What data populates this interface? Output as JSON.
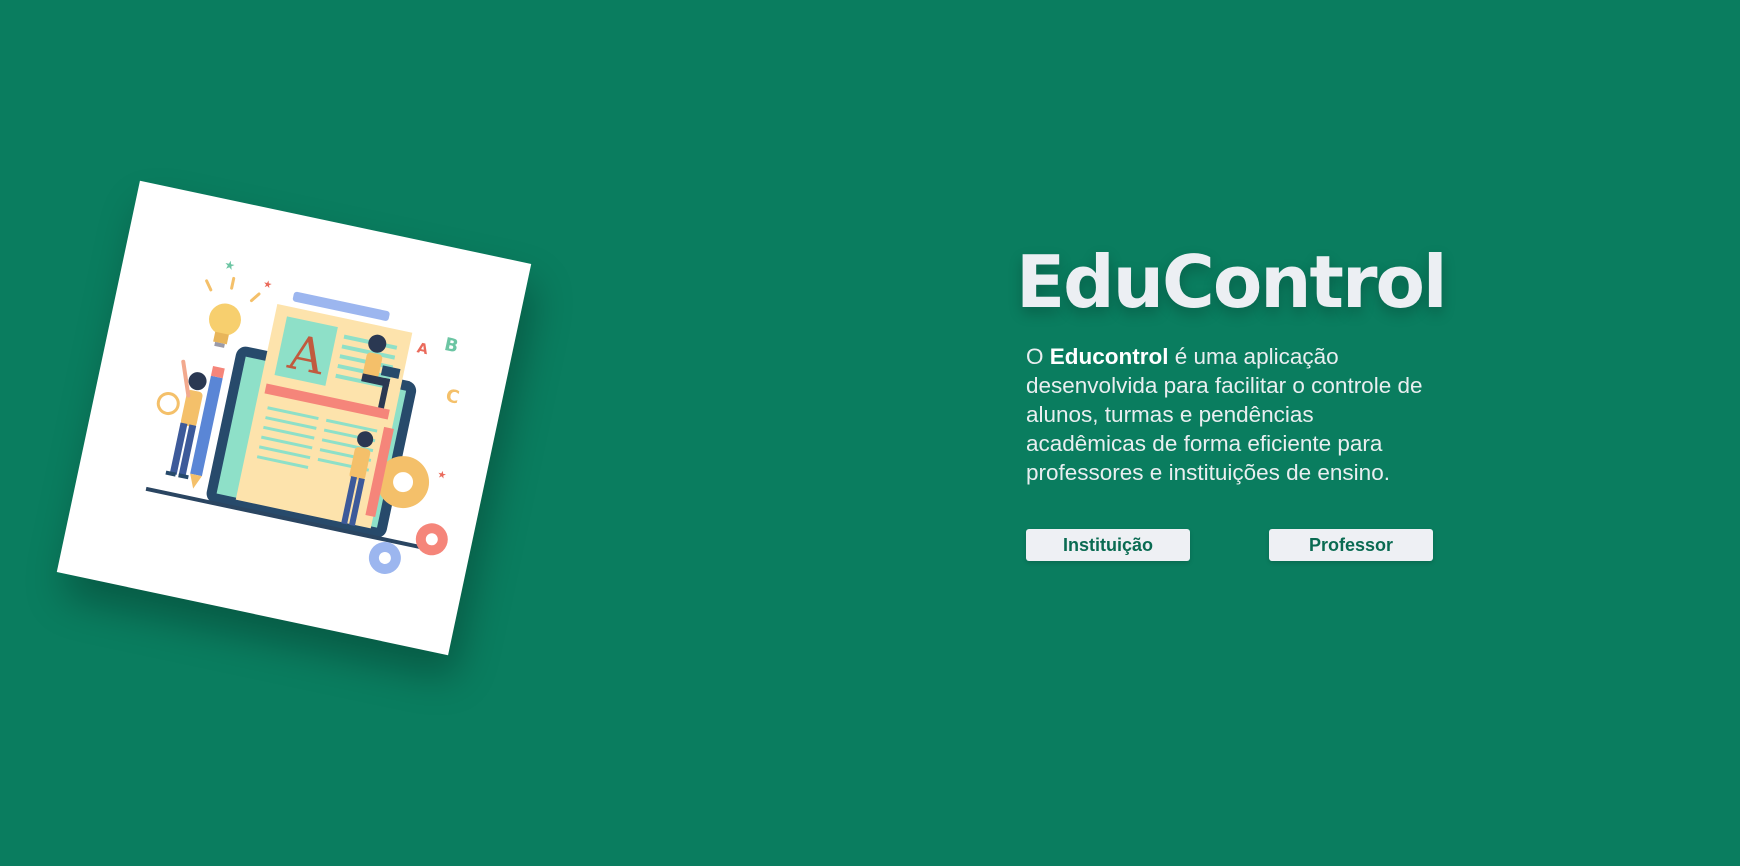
{
  "brand": {
    "title": "EduControl"
  },
  "description": {
    "prefix": "O ",
    "highlight": "Educontrol",
    "suffix": " é uma aplicação desenvolvida para facilitar o controle de alunos, turmas e pendências acadêmicas de forma eficiente para professores e instituições de ensino."
  },
  "actions": {
    "institution_label": "Instituição",
    "teacher_label": "Professor"
  },
  "illustration": {
    "name": "education-illustration",
    "letter": "A",
    "floating_letters": [
      "A",
      "B",
      "C"
    ]
  },
  "colors": {
    "background": "#0a7d5f",
    "button_text": "#0a6b52",
    "button_bg": "#eef0f4"
  }
}
